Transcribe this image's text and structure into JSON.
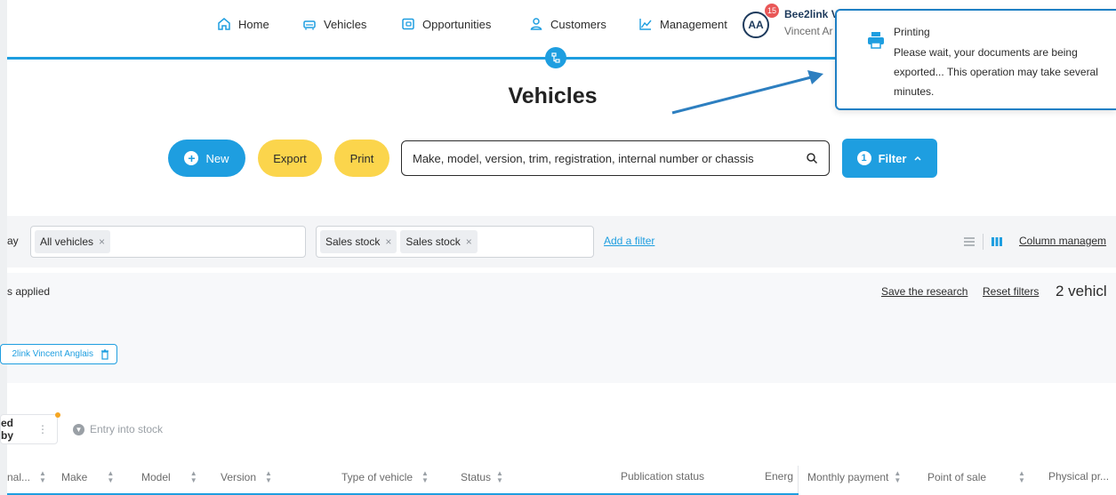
{
  "nav": {
    "home": "Home",
    "vehicles": "Vehicles",
    "opportunities": "Opportunities",
    "customers": "Customers",
    "management": "Management"
  },
  "user": {
    "initials": "AA",
    "notifications": "15",
    "name": "Bee2link V",
    "sub": "Vincent Ar"
  },
  "page": {
    "title": "Vehicles"
  },
  "actions": {
    "new": "New",
    "export": "Export",
    "print": "Print",
    "search_placeholder": "Make, model, version, trim, registration, internal number or chassis",
    "filter_count": "1",
    "filter": "Filter"
  },
  "filters": {
    "display_label": "ay",
    "display_chip": "All vehicles",
    "stock_chips": [
      "Sales stock",
      "Sales stock"
    ],
    "add_filter": "Add a filter",
    "column_management": "Column managem",
    "applied": "s applied",
    "save_research": "Save the research",
    "reset_filters": "Reset filters",
    "vehicle_count": "2 vehicl",
    "owner_chip": "2link Vincent Anglais"
  },
  "sort": {
    "sorted_by": "ed by",
    "entry_stock": "Entry into stock"
  },
  "table": {
    "headers": [
      "nal...",
      "Make",
      "Model",
      "Version",
      "Type of vehicle",
      "Status",
      "Publication status",
      "Energ",
      "Monthly payment",
      "Point of sale",
      "Physical pr..."
    ]
  },
  "toast": {
    "title": "Printing",
    "message": "Please wait, your documents are being exported... This operation may take several minutes."
  },
  "colors": {
    "primary": "#1e9ee0",
    "yellow": "#fbd54c",
    "badge": "#e95757",
    "toast_border": "#1e7fc4"
  }
}
